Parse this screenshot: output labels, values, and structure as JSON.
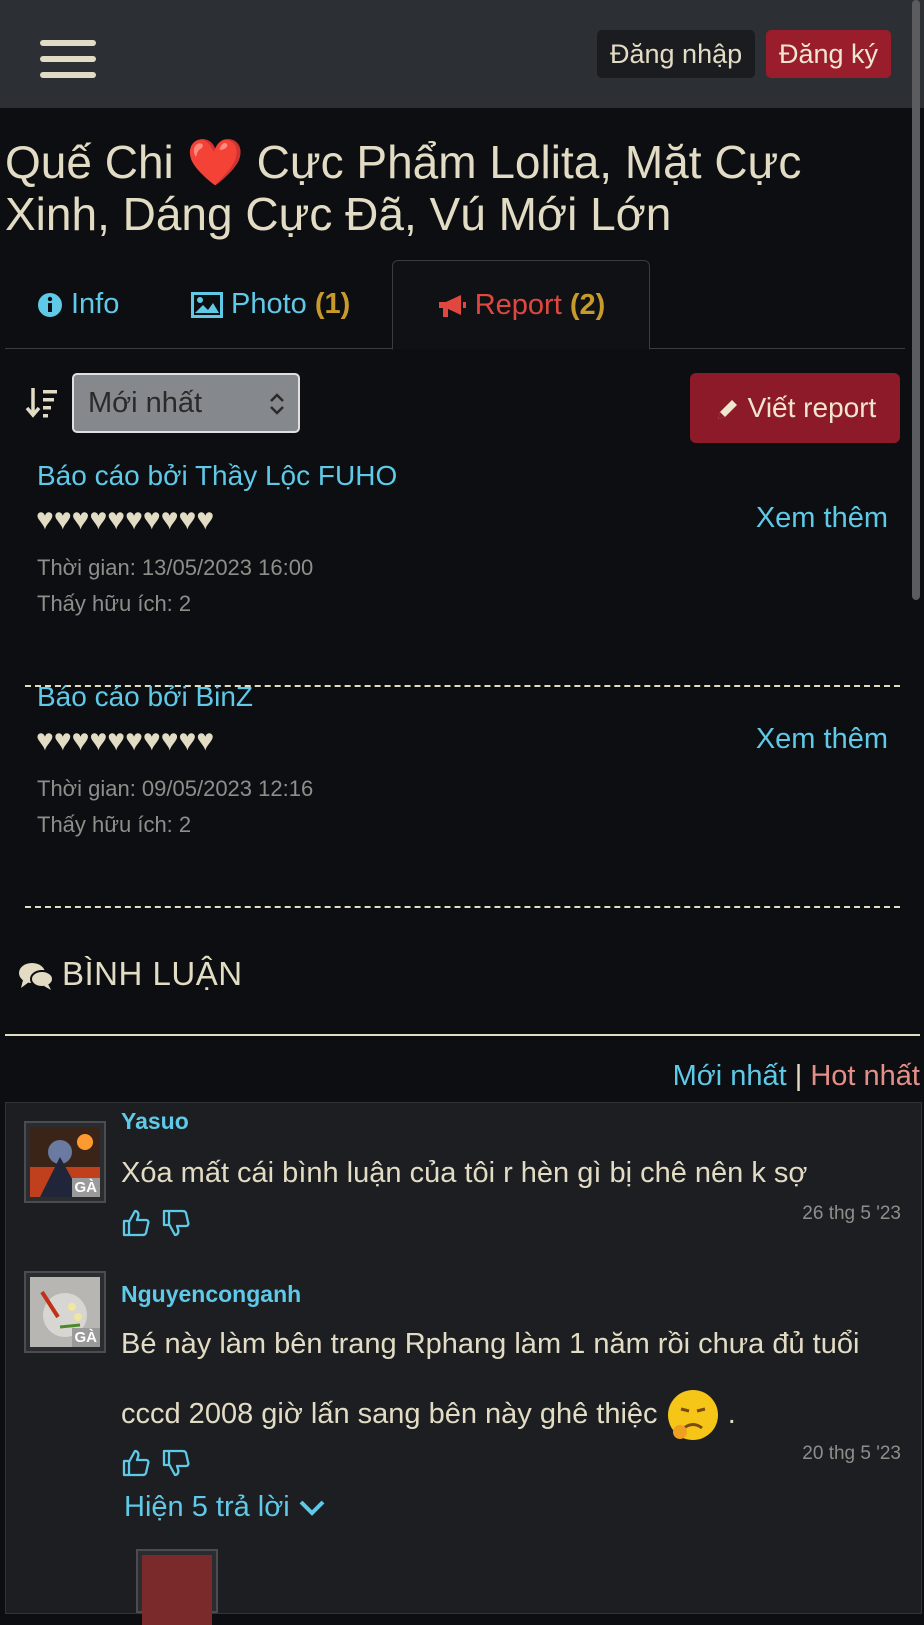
{
  "header": {
    "login": "Đăng nhập",
    "register": "Đăng ký"
  },
  "page": {
    "title_part1": "Quế Chi",
    "title_emoji": "❤️",
    "title_part2": " Cực Phẩm Lolita, Mặt Cực Xinh, Dáng Cực Đã, Vú Mới Lớn"
  },
  "tabs": [
    {
      "label": "Info",
      "count": ""
    },
    {
      "label": "Photo",
      "count": "(1)"
    },
    {
      "label": "Report",
      "count": "(2)"
    }
  ],
  "sort": {
    "selected": "Mới nhất"
  },
  "write_report": "Viết report",
  "reports": [
    {
      "title": "Báo cáo bởi Thầy Lộc FUHO",
      "hearts": "♥♥♥♥♥♥♥♥♥♥",
      "time": "Thời gian: 13/05/2023 16:00",
      "useful": "Thấy hữu ích: 2",
      "more": "Xem thêm"
    },
    {
      "title": "Báo cáo bởi BinZ",
      "hearts": "♥♥♥♥♥♥♥♥♥♥",
      "time": "Thời gian: 09/05/2023 12:16",
      "useful": "Thấy hữu ích: 2",
      "more": "Xem thêm"
    }
  ],
  "comments_section": {
    "heading": "BÌNH LUẬN",
    "sort_new": "Mới nhất",
    "sort_sep": "|",
    "sort_hot": "Hot nhất",
    "items": [
      {
        "user": "Yasuo",
        "badge": "GÀ",
        "text": "Xóa mất cái bình luận của tôi r hèn gì bị chê nên k sợ",
        "date": "26 thg 5 '23"
      },
      {
        "user": "Nguyenconganh",
        "badge": "GÀ",
        "text_line1": "Bé này làm bên trang Rphang làm 1 năm rồi chưa đủ tuổi",
        "text_line2": "cccd 2008 giờ lấn sang bên này ghê thiệc",
        "text_end": ".",
        "date": "20 thg 5 '23",
        "replies": "Hiện 5 trả lời"
      }
    ]
  },
  "colors": {
    "accent_link": "#5fc9e8",
    "primary_red": "#9a1d2c",
    "count_gold": "#c79a2c"
  }
}
